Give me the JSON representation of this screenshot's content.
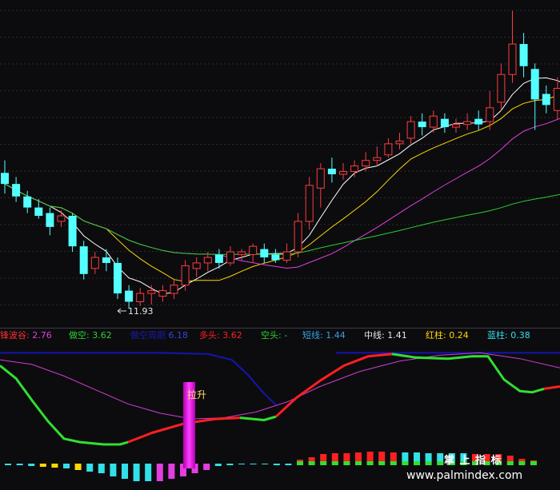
{
  "chart_data": [
    {
      "type": "candlestick",
      "title": "",
      "price_min": 11.93,
      "price_min_label": "11.93",
      "candles": [
        [
          12.91,
          12.83,
          13.0,
          12.76
        ],
        [
          12.83,
          12.74,
          12.88,
          12.7
        ],
        [
          12.74,
          12.66,
          12.78,
          12.62
        ],
        [
          12.66,
          12.6,
          12.72,
          12.58
        ],
        [
          12.62,
          12.52,
          12.66,
          12.46
        ],
        [
          12.56,
          12.6,
          12.64,
          12.52
        ],
        [
          12.6,
          12.38,
          12.62,
          12.34
        ],
        [
          12.38,
          12.18,
          12.42,
          12.14
        ],
        [
          12.22,
          12.3,
          12.34,
          12.18
        ],
        [
          12.3,
          12.26,
          12.36,
          12.2
        ],
        [
          12.26,
          12.04,
          12.3,
          12.0
        ],
        [
          12.06,
          11.98,
          12.1,
          11.93
        ],
        [
          11.98,
          12.04,
          12.08,
          11.95
        ],
        [
          12.04,
          12.06,
          12.1,
          11.96
        ],
        [
          12.02,
          12.06,
          12.1,
          11.98
        ],
        [
          12.04,
          12.1,
          12.14,
          12.0
        ],
        [
          12.1,
          12.24,
          12.28,
          12.06
        ],
        [
          12.22,
          12.26,
          12.3,
          12.16
        ],
        [
          12.26,
          12.3,
          12.34,
          12.2
        ],
        [
          12.32,
          12.26,
          12.36,
          12.22
        ],
        [
          12.26,
          12.34,
          12.38,
          12.24
        ],
        [
          12.32,
          12.34,
          12.36,
          12.28
        ],
        [
          12.32,
          12.38,
          12.4,
          12.26
        ],
        [
          12.36,
          12.3,
          12.4,
          12.26
        ],
        [
          12.32,
          12.28,
          12.36,
          12.26
        ],
        [
          12.28,
          12.34,
          12.4,
          12.26
        ],
        [
          12.34,
          12.56,
          12.62,
          12.3
        ],
        [
          12.56,
          12.82,
          12.88,
          12.5
        ],
        [
          12.8,
          12.94,
          12.98,
          12.66
        ],
        [
          12.94,
          12.9,
          13.02,
          12.84
        ],
        [
          12.9,
          12.92,
          12.98,
          12.86
        ],
        [
          12.92,
          12.96,
          13.0,
          12.88
        ],
        [
          12.96,
          13.0,
          13.06,
          12.92
        ],
        [
          13.0,
          13.02,
          13.1,
          12.96
        ],
        [
          13.04,
          13.12,
          13.16,
          13.02
        ],
        [
          13.12,
          13.14,
          13.2,
          13.08
        ],
        [
          13.16,
          13.28,
          13.32,
          13.12
        ],
        [
          13.28,
          13.24,
          13.34,
          13.18
        ],
        [
          13.24,
          13.32,
          13.36,
          13.2
        ],
        [
          13.3,
          13.24,
          13.34,
          13.2
        ],
        [
          13.24,
          13.26,
          13.3,
          13.2
        ],
        [
          13.26,
          13.28,
          13.34,
          13.22
        ],
        [
          13.3,
          13.26,
          13.36,
          13.22
        ],
        [
          13.28,
          13.38,
          13.5,
          13.22
        ],
        [
          13.42,
          13.62,
          13.7,
          13.36
        ],
        [
          13.62,
          13.84,
          14.08,
          13.56
        ],
        [
          13.84,
          13.68,
          13.92,
          13.6
        ],
        [
          13.66,
          13.44,
          13.7,
          13.22
        ],
        [
          13.48,
          13.4,
          13.54,
          13.34
        ],
        [
          13.36,
          13.52,
          13.6,
          13.3
        ],
        [
          13.56,
          13.64,
          13.76,
          13.5
        ]
      ],
      "ma_lines": [
        {
          "name": "MA5",
          "color": "#ffffff"
        },
        {
          "name": "MA10",
          "color": "#ffd700"
        },
        {
          "name": "MA20",
          "color": "#e23ee0"
        },
        {
          "name": "MA60",
          "color": "#2ecc2e"
        }
      ]
    },
    {
      "type": "line",
      "header_items": [
        {
          "label": "锋波谷:",
          "value": "2.76",
          "label_color": "#ff3030",
          "value_color": "#e040e0"
        },
        {
          "label": "做空:",
          "value": "3.62",
          "label_color": "#2ed12e",
          "value_color": "#2ed12e"
        },
        {
          "label": "做空周期",
          "value": "6.18",
          "label_color": "#1a1aa8",
          "value_color": "#2f46d6"
        },
        {
          "label": "多头:",
          "value": "3.62",
          "label_color": "#ff2020",
          "value_color": "#ff2020"
        },
        {
          "label": "空头:",
          "value": "-",
          "label_color": "#2ed12e",
          "value_color": "#2ed12e"
        },
        {
          "label": "短线:",
          "value": "1.44",
          "label_color": "#3aa0e0",
          "value_color": "#3aa0e0"
        },
        {
          "label": "中线:",
          "value": "1.41",
          "label_color": "#e8e8e8",
          "value_color": "#e8e8e8"
        },
        {
          "label": "红柱:",
          "value": "0.24",
          "label_color": "#ffd700",
          "value_color": "#ffd700"
        },
        {
          "label": "蓝柱:",
          "value": "0.38",
          "label_color": "#33e0e8",
          "value_color": "#33e0e8"
        }
      ],
      "annotation": "拉升",
      "watermark_cn": "掌 上 指 标",
      "watermark_url": "www.palmindex.com"
    }
  ]
}
